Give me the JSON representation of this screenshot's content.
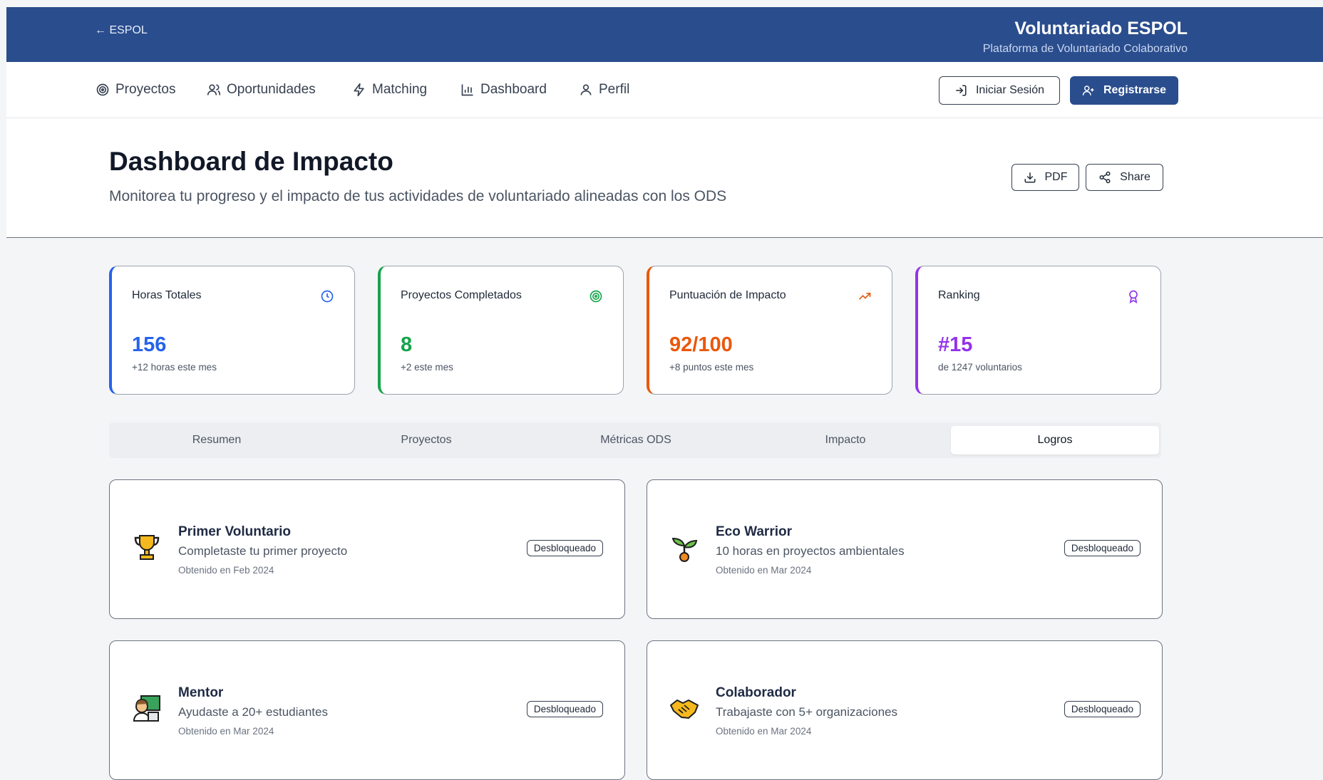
{
  "banner": {
    "back_link": "← ESPOL",
    "title": "Voluntariado ESPOL",
    "subtitle": "Plataforma de Voluntariado Colaborativo",
    "color": "#2a4d8d"
  },
  "nav": {
    "items": [
      {
        "label": "Proyectos",
        "icon": "target-icon"
      },
      {
        "label": "Oportunidades",
        "icon": "users-icon"
      },
      {
        "label": "Matching",
        "icon": "bolt-icon"
      },
      {
        "label": "Dashboard",
        "icon": "bar-chart-icon"
      },
      {
        "label": "Perfil",
        "icon": "user-icon"
      }
    ],
    "login_label": "Iniciar Sesión",
    "register_label": "Registrarse"
  },
  "header": {
    "title": "Dashboard de Impacto",
    "subtitle": "Monitorea tu progreso y el impacto de tus actividades de voluntariado alineadas con los ODS",
    "pdf_label": "PDF",
    "share_label": "Share"
  },
  "stats": [
    {
      "label": "Horas Totales",
      "value": "156",
      "sub": "+12 horas este mes",
      "color": "#2563eb",
      "icon": "clock-icon"
    },
    {
      "label": "Proyectos Completados",
      "value": "8",
      "sub": "+2 este mes",
      "color": "#16a34a",
      "icon": "target-icon"
    },
    {
      "label": "Puntuación de Impacto",
      "value": "92/100",
      "sub": "+8 puntos este mes",
      "color": "#ea580c",
      "icon": "trending-up-icon"
    },
    {
      "label": "Ranking",
      "value": "#15",
      "sub": "de 1247 voluntarios",
      "color": "#9333ea",
      "icon": "award-icon"
    }
  ],
  "tabs": {
    "items": [
      "Resumen",
      "Proyectos",
      "Métricas ODS",
      "Impacto",
      "Logros"
    ],
    "active": "Logros"
  },
  "achievements": [
    {
      "title": "Primer Voluntario",
      "desc": "Completaste tu primer proyecto",
      "date": "Obtenido en Feb 2024",
      "badge": "Desbloqueado",
      "icon": "trophy-icon"
    },
    {
      "title": "Eco Warrior",
      "desc": "10 horas en proyectos ambientales",
      "date": "Obtenido en Mar 2024",
      "badge": "Desbloqueado",
      "icon": "seedling-icon"
    },
    {
      "title": "Mentor",
      "desc": "Ayudaste a 20+ estudiantes",
      "date": "Obtenido en Mar 2024",
      "badge": "Desbloqueado",
      "icon": "teacher-icon"
    },
    {
      "title": "Colaborador",
      "desc": "Trabajaste con 5+ organizaciones",
      "date": "Obtenido en Mar 2024",
      "badge": "Desbloqueado",
      "icon": "handshake-icon"
    }
  ]
}
